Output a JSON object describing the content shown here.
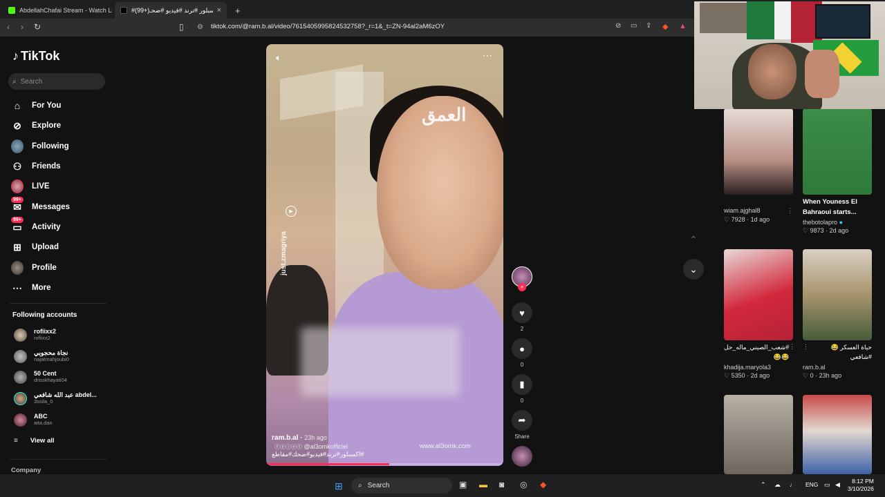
{
  "browser": {
    "tabs": [
      {
        "title": "AbdellahChafai Stream - Watch Live",
        "active": false,
        "favicon_color": "#53fc18"
      },
      {
        "title": "#اكسبلور #ترند #فيديو #ضحـ(+99)",
        "active": true,
        "favicon_color": "#000000"
      }
    ],
    "new_tab": "+",
    "url": "tiktok.com/@ram.b.al/video/7615405995824532758?_r=1&_t=ZN-94al2aM6zOY"
  },
  "sidebar": {
    "brand": "TikTok",
    "search_placeholder": "Search",
    "nav": [
      {
        "label": "For You",
        "icon": "home-icon"
      },
      {
        "label": "Explore",
        "icon": "compass-icon"
      },
      {
        "label": "Following",
        "icon": "avatar"
      },
      {
        "label": "Friends",
        "icon": "friends-icon"
      },
      {
        "label": "LIVE",
        "icon": "avatar"
      },
      {
        "label": "Messages",
        "icon": "messages-icon",
        "badge": "99+"
      },
      {
        "label": "Activity",
        "icon": "activity-icon",
        "badge": "99+"
      },
      {
        "label": "Upload",
        "icon": "upload-icon"
      },
      {
        "label": "Profile",
        "icon": "avatar"
      },
      {
        "label": "More",
        "icon": "more-icon"
      }
    ],
    "following_title": "Following accounts",
    "accounts": [
      {
        "name": "rofiixx2",
        "handle": "rofiixx2"
      },
      {
        "name": "نجاة محجوبي",
        "handle": "najatmahjoubi0"
      },
      {
        "name": "50 Cent",
        "handle": "drisskhayati04"
      },
      {
        "name": "عبد الله شافعي abdel...",
        "handle": "3ssila_0"
      },
      {
        "name": "ABC",
        "handle": "aita.dan"
      }
    ],
    "view_all": "View all",
    "company": "Company"
  },
  "video": {
    "watermark": "العمق",
    "side_text": "just.zmagriya",
    "username": "ram.b.al",
    "time_ago": "23h ago",
    "social_handle": "@al3omkofficiel",
    "hashtags": "#اكسبلور#ترند#فيديو#ضحك#مقاطع",
    "site": "www.al3omk.com",
    "progress": 0.52
  },
  "actions": {
    "likes": "2",
    "comments": "0",
    "saves": "0",
    "share_label": "Share"
  },
  "feed": [
    {
      "title": "",
      "user": "wiam.ajghal8",
      "likes": "7928",
      "age": "1d ago",
      "verified": false
    },
    {
      "title": "When Youness El Bahraoui starts...",
      "user": "thebotolapro",
      "likes": "9873",
      "age": "2d ago",
      "verified": true
    },
    {
      "title": "#شعب_الصيني_ماله_حل 😂😂",
      "user": "khadija.maryola3",
      "likes": "5350",
      "age": "2d ago",
      "verified": false
    },
    {
      "title": "حياة العسكر 😂 #شافعي",
      "user": "ram.b.al",
      "likes": "0",
      "age": "23h ago",
      "verified": false
    }
  ],
  "feed_thumb_colors": [
    "#d7c4c3",
    "#3f8a46",
    "#d23a4a",
    "#a9a39a",
    "#6f6a62",
    "#c94b4b"
  ],
  "taskbar": {
    "search": "Search",
    "lang": "ENG",
    "time": "8:12 PM",
    "date": "3/10/2026"
  }
}
